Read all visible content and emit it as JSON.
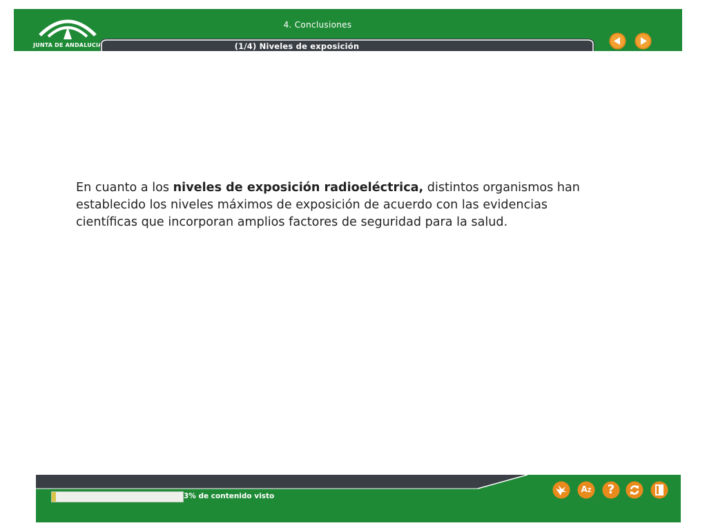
{
  "header": {
    "logo_text": "JUNTA DE ANDALUCIA",
    "section_title": "4. Conclusiones",
    "subtitle": "(1/4) Niveles de exposición",
    "prev_icon": "arrow-left-icon",
    "next_icon": "arrow-right-icon"
  },
  "content": {
    "paragraph_part1": "En cuanto a los ",
    "paragraph_bold": "niveles de exposición radioeléctrica,",
    "paragraph_part2": " distintos organismos han establecido los niveles máximos de exposición de acuerdo con las evidencias científicas que incorporan amplios factores de seguridad para la salud."
  },
  "footer": {
    "progress_percent": 3,
    "progress_label": "3% de contenido visto",
    "tools": [
      "bird-icon",
      "glossary-az-icon",
      "help-icon",
      "refresh-icon",
      "exit-door-icon"
    ],
    "glossary_label": "A",
    "glossary_sub": "Z",
    "help_label": "?"
  },
  "colors": {
    "brand_green": "#1f8a36",
    "dark_band": "#3a3f45",
    "orange_button": "#e98a1c",
    "progress_fill": "#d9c44a"
  }
}
